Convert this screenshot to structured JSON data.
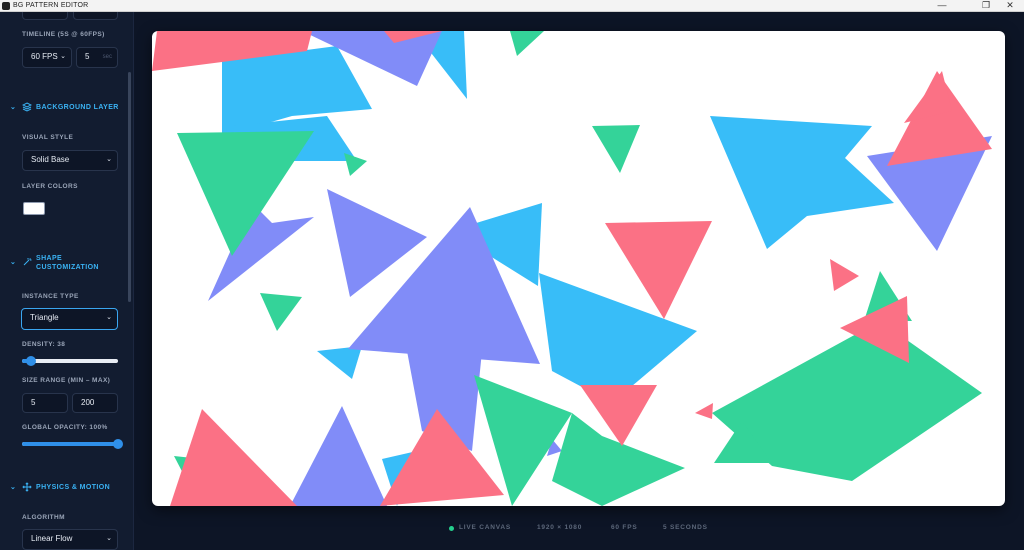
{
  "window": {
    "title": "BG PATTERN EDITOR",
    "minimize": "—",
    "restore": "❐",
    "close": "✕"
  },
  "sidebar": {
    "timeline": {
      "label": "TIMELINE (5S @ 60FPS)",
      "fps_value": "60 FPS",
      "duration_value": "5",
      "duration_unit": "sec"
    },
    "background_layer": {
      "title": "BACKGROUND LAYER",
      "visual_style_label": "VISUAL STYLE",
      "visual_style_value": "Solid Base",
      "layer_colors_label": "LAYER COLORS",
      "color": "#ffffff"
    },
    "shape": {
      "title_line1": "SHAPE",
      "title_line2": "CUSTOMIZATION",
      "instance_type_label": "INSTANCE TYPE",
      "instance_type_value": "Triangle",
      "density_label": "DENSITY: 38",
      "density": 38,
      "size_range_label": "SIZE RANGE (MIN – MAX)",
      "size_min": "5",
      "size_max": "200",
      "opacity_label": "GLOBAL OPACITY: 100%",
      "opacity": 100
    },
    "physics": {
      "title": "PHYSICS & MOTION",
      "algorithm_label": "ALGORITHM",
      "algorithm_value": "Linear Flow"
    }
  },
  "footer": {
    "live": "LIVE CANVAS",
    "resolution": "1920 × 1080",
    "fps": "60 FPS",
    "duration": "5 SECONDS"
  },
  "palette": {
    "blue": "#38bdf8",
    "violet": "#818cf8",
    "green": "#34d399",
    "red": "#fb7185",
    "accent": "#3ab2f3",
    "live": "#25d08e"
  }
}
